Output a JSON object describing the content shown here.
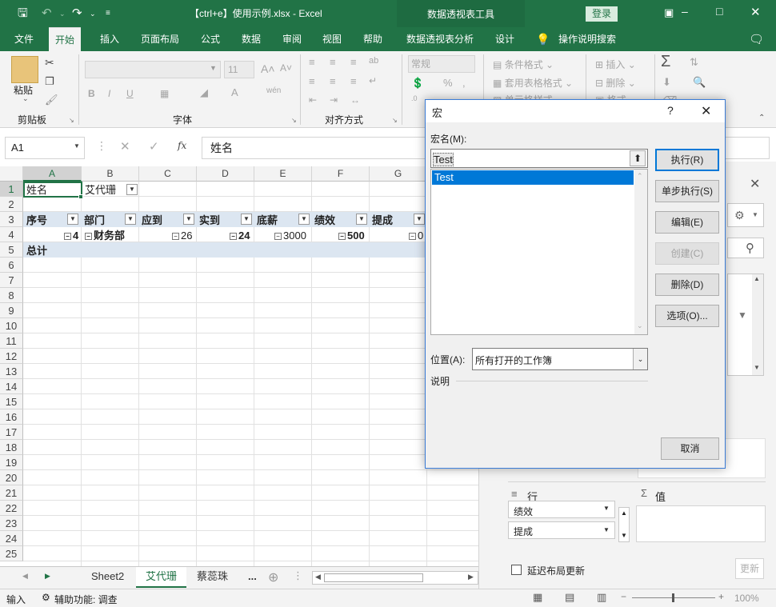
{
  "titlebar": {
    "title": "【ctrl+e】使用示例.xlsx  -  Excel",
    "context_tool": "数据透视表工具",
    "login": "登录"
  },
  "tabs": [
    "文件",
    "开始",
    "插入",
    "页面布局",
    "公式",
    "数据",
    "审阅",
    "视图",
    "帮助",
    "数据透视表分析",
    "设计"
  ],
  "active_tab": "开始",
  "tell_me": "操作说明搜索",
  "ribbon": {
    "paste": "粘贴",
    "clipboard": "剪贴板",
    "font_group": "字体",
    "font_size": "11",
    "align_group": "对齐方式",
    "number_format": "常规",
    "cond_format": "条件格式",
    "table_format": "套用表格格式",
    "cell_style": "单元格样式",
    "insert": "插入",
    "delete": "删除",
    "format": "格式"
  },
  "formula_bar": {
    "name_box": "A1",
    "fx": "fx",
    "value": "姓名"
  },
  "columns": [
    "A",
    "B",
    "C",
    "D",
    "E",
    "F",
    "G"
  ],
  "rows": [
    "1",
    "2",
    "3",
    "4",
    "5",
    "6",
    "7",
    "8",
    "9",
    "10",
    "11",
    "12",
    "13",
    "14",
    "15",
    "16",
    "17",
    "18",
    "19",
    "20",
    "21",
    "22",
    "23",
    "24",
    "25"
  ],
  "pivot": {
    "filter_label": "姓名",
    "filter_value": "艾代珊",
    "headers": [
      "序号",
      "部门",
      "应到",
      "实到",
      "底薪",
      "绩效",
      "提成"
    ],
    "row4": [
      "4",
      "财务部",
      "26",
      "24",
      "3000",
      "500",
      "0"
    ],
    "total": "总计"
  },
  "sheets": [
    "Sheet2",
    "艾代珊",
    "蔡蕊珠"
  ],
  "active_sheet": "艾代珊",
  "sheet_more": "...",
  "status": {
    "mode": "输入",
    "accessibility": "辅助功能: 调查",
    "zoom": "100%"
  },
  "panel": {
    "rows_label": "行",
    "values_label": "值",
    "row_fields": [
      "绩效",
      "提成"
    ],
    "defer_label": "延迟布局更新",
    "update_btn": "更新"
  },
  "dialog": {
    "title": "宏",
    "help": "?",
    "macro_name_label": "宏名(M):",
    "macro_name_value": "Test",
    "macro_list": [
      "Test"
    ],
    "buttons": {
      "run": "执行(R)",
      "step": "单步执行(S)",
      "edit": "编辑(E)",
      "create": "创建(C)",
      "delete": "删除(D)",
      "options": "选项(O)...",
      "cancel": "取消"
    },
    "location_label": "位置(A):",
    "location_value": "所有打开的工作簿",
    "description_label": "说明"
  },
  "colors": {
    "excel_green": "#217346",
    "pivot_header": "#dce6f1",
    "selection": "#0078d7"
  }
}
